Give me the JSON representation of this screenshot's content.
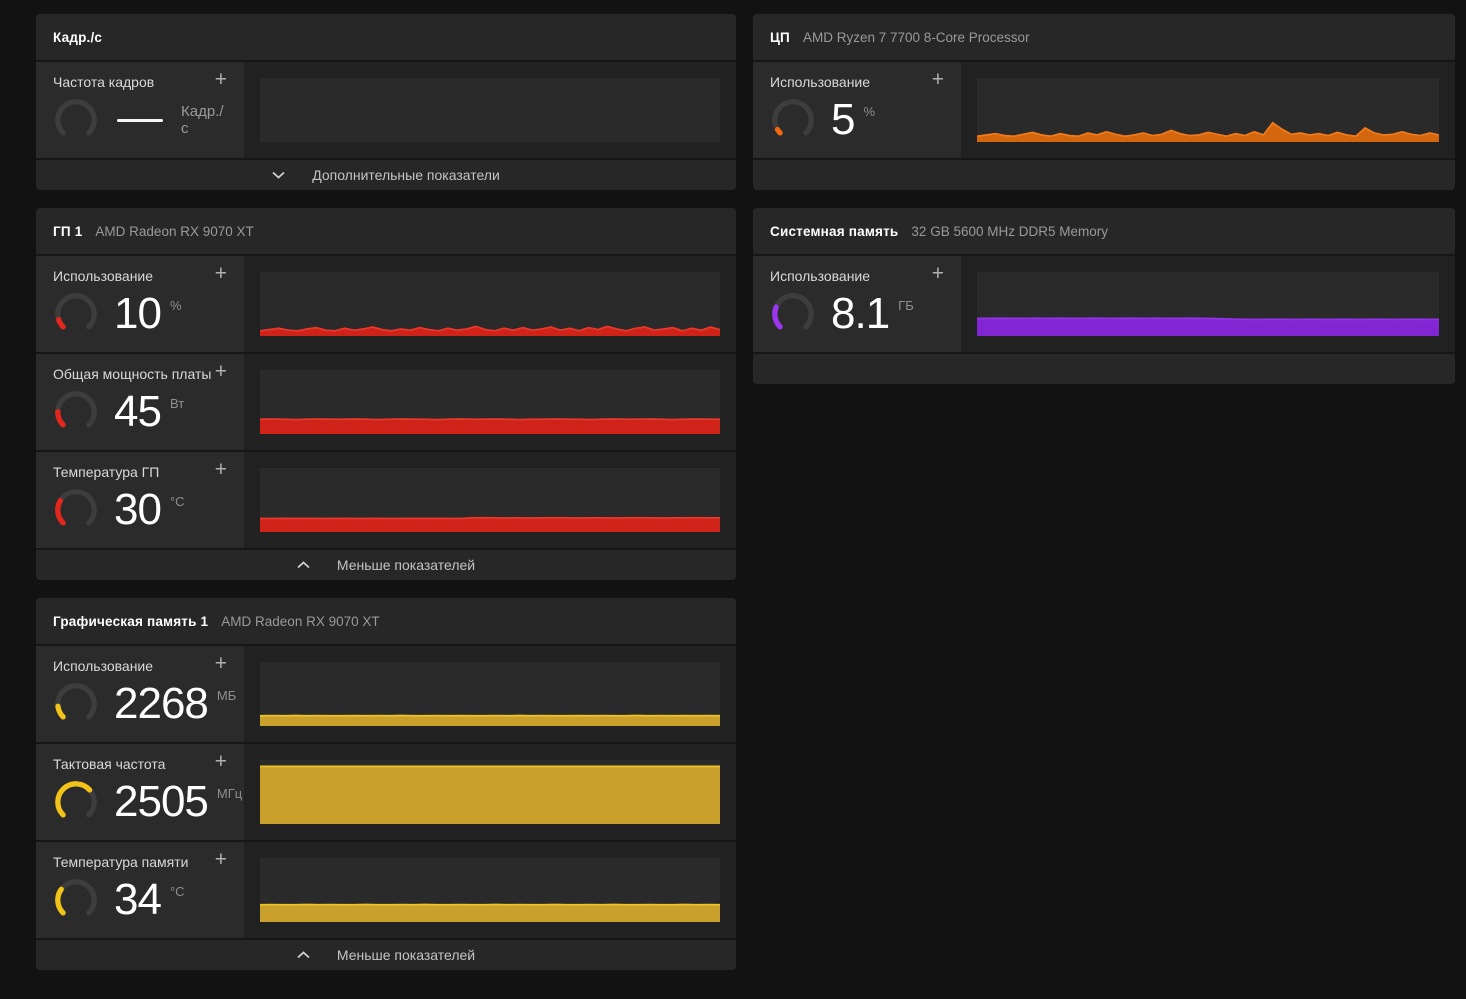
{
  "ui": {
    "add": "+",
    "gauge_track": "#3d3d3d"
  },
  "cards": {
    "fps": {
      "title": "Кадр./с",
      "metrics": [
        {
          "label": "Частота кадров",
          "value": "",
          "unit": "Кадр./с",
          "gauge": {
            "fraction": 0,
            "color": "#3d3d3d"
          },
          "spark": {
            "values": [],
            "fill": "none",
            "stroke": "none"
          }
        }
      ],
      "footer": {
        "label": "Дополнительные показатели"
      }
    },
    "cpu": {
      "title": "ЦП",
      "subtitle": "AMD Ryzen 7 7700 8-Core Processor",
      "metrics": [
        {
          "label": "Использование",
          "value": "5",
          "unit": "%",
          "gauge": {
            "fraction": 0.05,
            "color": "#f1680d"
          },
          "spark": {
            "values": [
              9,
              11,
              13,
              10,
              9,
              12,
              15,
              11,
              9,
              13,
              10,
              9,
              14,
              11,
              16,
              12,
              9,
              11,
              14,
              10,
              12,
              18,
              13,
              10,
              11,
              15,
              12,
              9,
              13,
              10,
              16,
              11,
              30,
              20,
              12,
              14,
              11,
              13,
              10,
              15,
              11,
              9,
              22,
              14,
              11,
              12,
              16,
              12,
              10,
              14,
              11
            ],
            "fill": "#d4660e",
            "stroke": "#f07a1c"
          }
        }
      ]
    },
    "gpu": {
      "title": "ГП 1",
      "subtitle": "AMD Radeon RX 9070 XT",
      "metrics": [
        {
          "label": "Использование",
          "value": "10",
          "unit": "%",
          "gauge": {
            "fraction": 0.1,
            "color": "#e3271c"
          },
          "spark": {
            "values": [
              8,
              10,
              12,
              9,
              8,
              11,
              13,
              9,
              8,
              12,
              9,
              11,
              14,
              10,
              8,
              11,
              9,
              13,
              10,
              8,
              12,
              9,
              11,
              15,
              10,
              8,
              12,
              9,
              13,
              9,
              11,
              14,
              9,
              12,
              8,
              13,
              10,
              15,
              11,
              8,
              12,
              14,
              9,
              11,
              13,
              8,
              12,
              9,
              14,
              10
            ],
            "fill": "#cf2218",
            "stroke": "#e8392c"
          }
        },
        {
          "label": "Общая мощность платы",
          "value": "45",
          "unit": "Вт",
          "gauge": {
            "fraction": 0.17,
            "color": "#e3271c"
          },
          "spark": {
            "values": [
              23,
              23.5,
              23,
              22.5,
              23,
              23.5,
              23,
              23,
              23.5,
              23,
              22.5,
              23,
              23.5,
              23,
              23,
              22.5,
              23,
              23.5,
              23,
              23,
              23.5,
              23,
              22.5,
              23,
              23,
              23.5,
              23,
              23,
              22.5,
              23,
              23.5,
              23,
              23,
              23.5,
              23,
              22.5,
              23,
              23.5,
              23,
              23
            ],
            "fill": "#cf2218",
            "stroke": "#e8392c"
          }
        },
        {
          "label": "Температура ГП",
          "value": "30",
          "unit": "°C",
          "gauge": {
            "fraction": 0.28,
            "color": "#e3271c"
          },
          "spark": {
            "values": [
              21,
              21,
              21.3,
              21,
              21.2,
              21,
              21,
              21.3,
              21,
              21,
              21.2,
              21,
              21,
              21.3,
              21,
              21.2,
              21,
              21,
              22,
              22.3,
              22,
              21.8,
              22,
              21.8,
              22,
              22.2,
              22,
              21.8,
              22,
              22,
              21.8,
              22,
              22.2,
              22,
              21.8,
              22,
              22,
              22.2,
              22,
              22
            ],
            "fill": "#cf2218",
            "stroke": "#e8392c"
          }
        }
      ],
      "footer": {
        "label": "Меньше показателей"
      }
    },
    "sysmem": {
      "title": "Системная память",
      "subtitle": "32 GB 5600 MHz DDR5 Memory",
      "metrics": [
        {
          "label": "Использование",
          "value": "8.1",
          "unit": "ГБ",
          "gauge": {
            "fraction": 0.25,
            "color": "#9a35f0"
          },
          "spark": {
            "values": [
              27.5,
              27.5,
              27.8,
              27.5,
              27.5,
              27.7,
              27.5,
              27.8,
              27.5,
              27.5,
              27.7,
              27.5,
              27.5,
              27.8,
              27.5,
              27.7,
              27.5,
              27.5,
              27.8,
              27.5,
              27.3,
              26.8,
              26.2,
              26,
              26,
              26.1,
              26,
              26,
              26.2,
              26,
              26,
              26.1,
              26,
              26,
              26.2,
              26,
              26,
              26.1,
              26,
              26
            ],
            "fill": "#8226d3",
            "stroke": "#9132e6"
          }
        }
      ]
    },
    "vram": {
      "title": "Графическая память 1",
      "subtitle": "AMD Radeon RX 9070 XT",
      "metrics": [
        {
          "label": "Использование",
          "value": "2268",
          "unit": "МБ",
          "gauge": {
            "fraction": 0.14,
            "color": "#f2c318"
          },
          "spark": {
            "values": [
              16,
              16.2,
              16,
              16.4,
              16,
              16.2,
              16,
              16,
              16.3,
              16,
              16.2,
              16,
              16.4,
              16,
              16,
              16.2,
              16,
              16.3,
              16,
              16,
              16.2,
              16,
              16.4,
              16,
              16.2,
              16,
              16,
              16.3,
              16,
              16.2,
              16,
              16,
              16.4,
              16,
              16.2,
              16,
              16.3,
              16,
              16.2,
              16
            ],
            "fill": "#c9a02c",
            "stroke": "#eec327"
          }
        },
        {
          "label": "Тактовая частота",
          "value": "2505",
          "unit": "МГц",
          "gauge": {
            "fraction": 0.68,
            "color": "#f2c318"
          },
          "spark": {
            "values": [
              90,
              90,
              90,
              90,
              90,
              90,
              90,
              90
            ],
            "fill": "#c9a02c",
            "stroke": "#eec327"
          }
        },
        {
          "label": "Температура памяти",
          "value": "34",
          "unit": "°C",
          "gauge": {
            "fraction": 0.3,
            "color": "#f2c318"
          },
          "spark": {
            "values": [
              27,
              27.2,
              27,
              27,
              27.3,
              27,
              27.2,
              27,
              27,
              27.3,
              27,
              27,
              27.2,
              27,
              27.3,
              27,
              27,
              27.2,
              27,
              27,
              27.3,
              27,
              27.2,
              27,
              27,
              27.3,
              27,
              27,
              27.2,
              27,
              27.3,
              27,
              27,
              27.2,
              27,
              27,
              27.3,
              27,
              27.2,
              27
            ],
            "fill": "#c9a02c",
            "stroke": "#eec327"
          }
        }
      ],
      "footer": {
        "label": "Меньше показателей"
      }
    }
  }
}
